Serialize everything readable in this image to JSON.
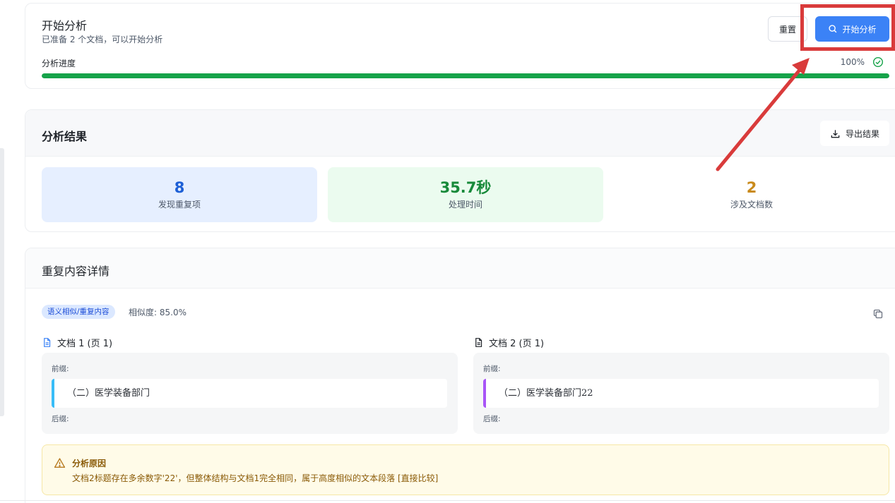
{
  "header": {
    "title": "开始分析",
    "subtitle": "已准备 2 个文档，可以开始分析",
    "reset_label": "重置",
    "start_label": "开始分析",
    "progress_label": "分析进度",
    "progress_value_text": "100%",
    "progress_fraction": 1.0
  },
  "results": {
    "title": "分析结果",
    "export_label": "导出结果",
    "stats": [
      {
        "value": "8",
        "label": "发现重复项"
      },
      {
        "value": "35.7秒",
        "label": "处理时间"
      },
      {
        "value": "2",
        "label": "涉及文档数"
      }
    ]
  },
  "details": {
    "title": "重复内容详情",
    "tag": "语义相似/重复内容",
    "similarity": "相似度: 85.0%",
    "docs": [
      {
        "header": "文档 1 (页 1)",
        "prefix_label": "前缀:",
        "content": "（二）医学装备部门",
        "suffix_label": "后缀:"
      },
      {
        "header": "文档 2 (页 1)",
        "prefix_label": "前缀:",
        "content": "（二）医学装备部门22",
        "suffix_label": "后缀:"
      }
    ],
    "reason_title": "分析原因",
    "reason_text": "文档2标题存在多余数字'22'，但整体结构与文档1完全相同，属于高度相似的文本段落 [直接比较]"
  },
  "colors": {
    "primary": "#3b82f6",
    "progress": "#16a34a",
    "annotation": "#d93b3b",
    "stat_blue": "#1d5fd6",
    "stat_green": "#178a3a",
    "stat_orange": "#c98a1b"
  },
  "icons": [
    "search-icon",
    "check-circle-icon",
    "download-icon",
    "copy-icon",
    "document-icon",
    "warning-icon"
  ]
}
